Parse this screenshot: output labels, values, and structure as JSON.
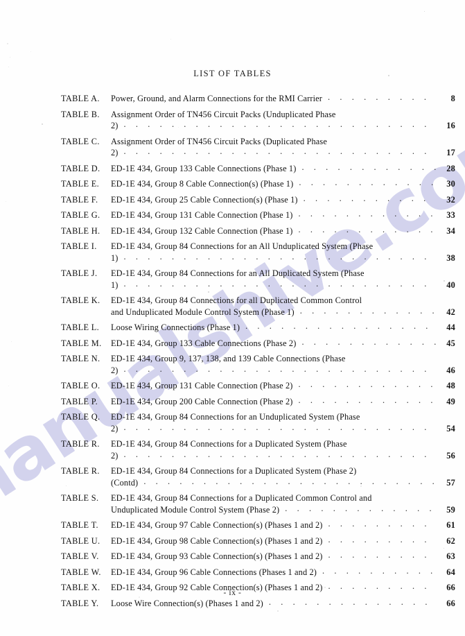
{
  "document": {
    "heading": "LIST OF TABLES",
    "folio": "- ix -",
    "watermark": "manualshive.com",
    "watermark_color": "#b9bae4"
  },
  "toc": {
    "entries": [
      {
        "label": "TABLE A.",
        "line1": "Power, Ground, and Alarm Connections for the RMI Carrier",
        "line2": "",
        "page": "8"
      },
      {
        "label": "TABLE B.",
        "line1": "Assignment Order of TN456 Circuit Packs (Unduplicated Phase",
        "line2": "2)",
        "page": "16"
      },
      {
        "label": "TABLE C.",
        "line1": "Assignment Order of TN456 Circuit Packs (Duplicated Phase",
        "line2": "2)",
        "page": "17"
      },
      {
        "label": "TABLE D.",
        "line1": "ED-1E 434, Group 133 Cable Connections (Phase 1)",
        "line2": "",
        "page": "28"
      },
      {
        "label": "TABLE E.",
        "line1": "ED-1E 434, Group 8 Cable Connection(s) (Phase 1)",
        "line2": "",
        "page": "30"
      },
      {
        "label": "TABLE F.",
        "line1": "ED-1E 434, Group 25 Cable Connection(s) (Phase 1)",
        "line2": "",
        "page": "32"
      },
      {
        "label": "TABLE G.",
        "line1": "ED-1E 434, Group 131 Cable Connection (Phase 1)",
        "line2": "",
        "page": "33"
      },
      {
        "label": "TABLE H.",
        "line1": "ED-1E 434, Group 132 Cable Connection (Phase 1)",
        "line2": "",
        "page": "34"
      },
      {
        "label": "TABLE I.",
        "line1": "ED-1E 434, Group 84 Connections for an All Unduplicated System (Phase",
        "line2": "1)",
        "page": "38"
      },
      {
        "label": "TABLE J.",
        "line1": "ED-1E 434, Group 84 Connections for an All Duplicated System (Phase",
        "line2": "1)",
        "page": "40"
      },
      {
        "label": "TABLE K.",
        "line1": "ED-1E 434, Group 84 Connections for all Duplicated Common Control",
        "line2": "and Unduplicated Module Control System (Phase 1)",
        "page": "42"
      },
      {
        "label": "TABLE L.",
        "line1": "Loose Wiring Connections (Phase 1)",
        "line2": "",
        "page": "44"
      },
      {
        "label": "TABLE M.",
        "line1": "ED-1E 434, Group 133 Cable Connections (Phase 2)",
        "line2": "",
        "page": "45"
      },
      {
        "label": "TABLE N.",
        "line1": "ED-1E 434, Group 9, 137, 138, and 139 Cable Connections (Phase",
        "line2": "2)",
        "page": "46"
      },
      {
        "label": "TABLE O.",
        "line1": "ED-1E 434, Group 131 Cable Connection (Phase 2)",
        "line2": "",
        "page": "48"
      },
      {
        "label": "TABLE P.",
        "line1": "ED-1E 434, Group 200 Cable Connection (Phase 2)",
        "line2": "",
        "page": "49"
      },
      {
        "label": "TABLE Q.",
        "line1": "ED-1E 434, Group 84 Connections for an Unduplicated System (Phase",
        "line2": "2)",
        "page": "54"
      },
      {
        "label": "TABLE R.",
        "line1": "ED-1E 434, Group 84 Connections for a Duplicated System (Phase",
        "line2": "2)",
        "page": "56"
      },
      {
        "label": "TABLE R.",
        "line1": "ED-1E 434, Group 84 Connections for a Duplicated System (Phase 2)",
        "line2": "(Contd)",
        "page": "57"
      },
      {
        "label": "TABLE S.",
        "line1": "ED-1E 434, Group 84 Connections for a Duplicated Common Control and",
        "line2": "Unduplicated Module Control System (Phase 2)",
        "page": "59"
      },
      {
        "label": "TABLE T.",
        "line1": "ED-1E 434, Group 97 Cable Connection(s) (Phases 1 and 2)",
        "line2": "",
        "page": "61"
      },
      {
        "label": "TABLE U.",
        "line1": "ED-1E 434, Group 98 Cable Connection(s) (Phases 1 and 2)",
        "line2": "",
        "page": "62"
      },
      {
        "label": "TABLE V.",
        "line1": "ED-1E 434, Group 93 Cable Connection(s) (Phases 1 and 2)",
        "line2": "",
        "page": "63"
      },
      {
        "label": "TABLE W.",
        "line1": "ED-1E 434, Group 96 Cable Connections (Phases 1 and 2)",
        "line2": "",
        "page": "64"
      },
      {
        "label": "TABLE X.",
        "line1": "ED-1E 434, Group 92 Cable Connection(s) (Phases 1 and 2)",
        "line2": "",
        "page": "66"
      },
      {
        "label": "TABLE Y.",
        "line1": "Loose Wire Connection(s) (Phases 1 and 2)",
        "line2": "",
        "page": "66"
      }
    ]
  }
}
